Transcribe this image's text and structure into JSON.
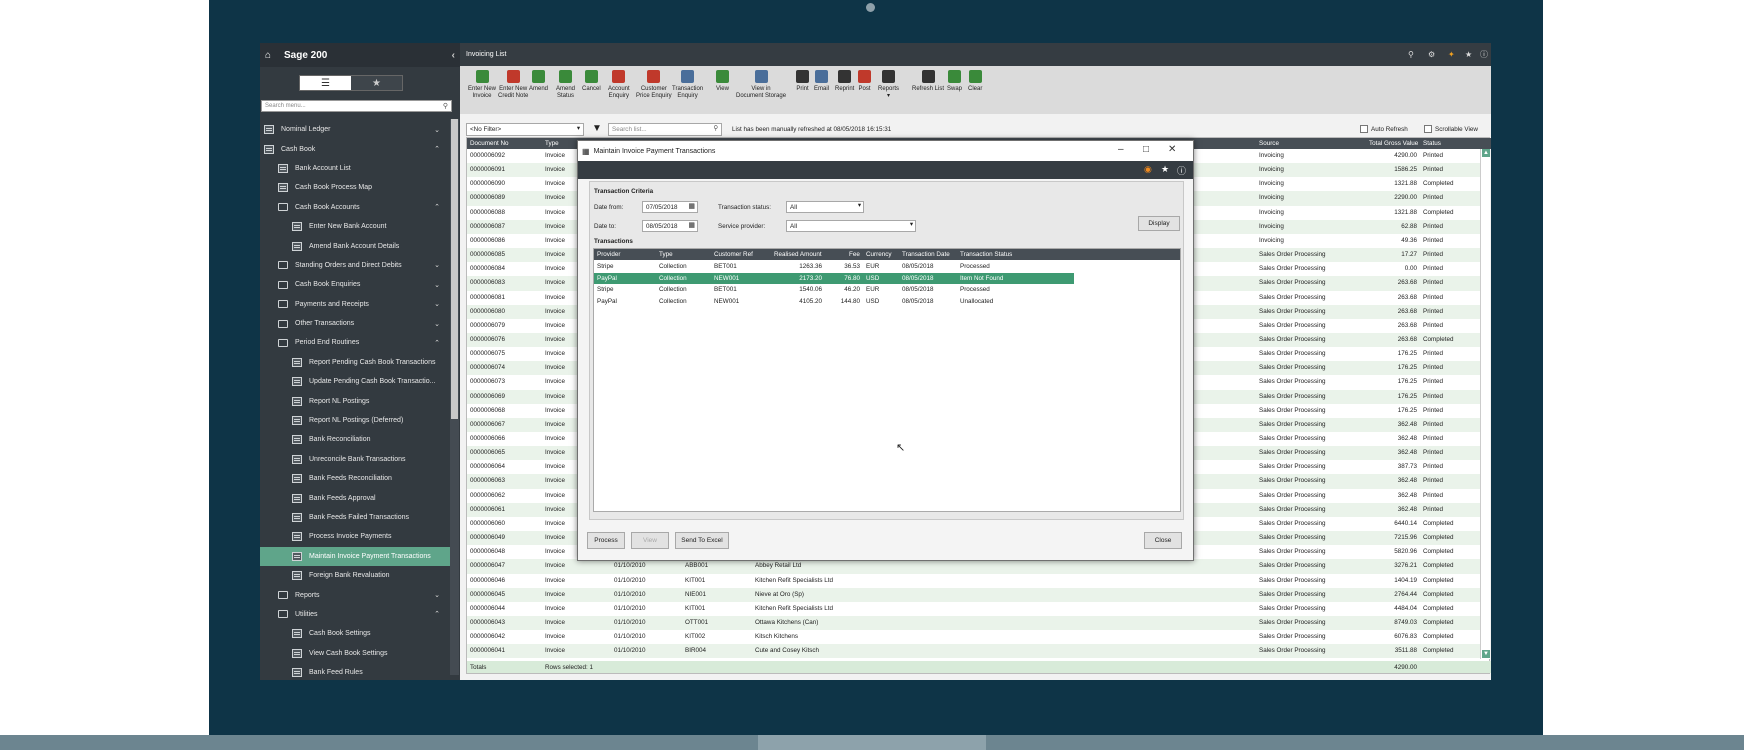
{
  "app": {
    "name": "Sage 200",
    "window_title": "Invoicing List"
  },
  "sidebar": {
    "search_placeholder": "Search menu...",
    "items": [
      {
        "label": "Nominal Ledger",
        "level": 0,
        "icon": "ledger-icon",
        "chev": "⌄"
      },
      {
        "label": "Cash Book",
        "level": 0,
        "icon": "cashbook-icon",
        "chev": "⌃"
      },
      {
        "label": "Bank Account List",
        "level": 1,
        "icon": "doc-icon",
        "chev": ""
      },
      {
        "label": "Cash Book Process Map",
        "level": 1,
        "icon": "doc-icon",
        "chev": ""
      },
      {
        "label": "Cash Book Accounts",
        "level": 1,
        "icon": "folder-icon",
        "chev": "⌃"
      },
      {
        "label": "Enter New Bank Account",
        "level": 2,
        "icon": "doc-icon",
        "chev": ""
      },
      {
        "label": "Amend Bank Account Details",
        "level": 2,
        "icon": "doc-icon",
        "chev": ""
      },
      {
        "label": "Standing Orders and Direct Debits",
        "level": 1,
        "icon": "folder-icon",
        "chev": "⌄"
      },
      {
        "label": "Cash Book Enquiries",
        "level": 1,
        "icon": "folder-icon",
        "chev": "⌄"
      },
      {
        "label": "Payments and Receipts",
        "level": 1,
        "icon": "folder-icon",
        "chev": "⌄"
      },
      {
        "label": "Other Transactions",
        "level": 1,
        "icon": "folder-icon",
        "chev": "⌄"
      },
      {
        "label": "Period End Routines",
        "level": 1,
        "icon": "folder-icon",
        "chev": "⌃"
      },
      {
        "label": "Report Pending Cash Book Transactions",
        "level": 2,
        "icon": "doc-icon",
        "chev": ""
      },
      {
        "label": "Update Pending Cash Book Transactio...",
        "level": 2,
        "icon": "doc-icon",
        "chev": ""
      },
      {
        "label": "Report NL Postings",
        "level": 2,
        "icon": "doc-icon",
        "chev": ""
      },
      {
        "label": "Report NL Postings (Deferred)",
        "level": 2,
        "icon": "doc-icon",
        "chev": ""
      },
      {
        "label": "Bank Reconciliation",
        "level": 2,
        "icon": "doc-icon",
        "chev": ""
      },
      {
        "label": "Unreconcile Bank Transactions",
        "level": 2,
        "icon": "doc-icon",
        "chev": ""
      },
      {
        "label": "Bank Feeds Reconciliation",
        "level": 2,
        "icon": "doc-icon",
        "chev": ""
      },
      {
        "label": "Bank Feeds Approval",
        "level": 2,
        "icon": "doc-icon",
        "chev": ""
      },
      {
        "label": "Bank Feeds Failed Transactions",
        "level": 2,
        "icon": "doc-icon",
        "chev": ""
      },
      {
        "label": "Process Invoice Payments",
        "level": 2,
        "icon": "doc-icon",
        "chev": ""
      },
      {
        "label": "Maintain Invoice Payment Transactions",
        "level": 2,
        "icon": "doc-icon",
        "chev": "",
        "selected": true
      },
      {
        "label": "Foreign Bank Revaluation",
        "level": 2,
        "icon": "doc-icon",
        "chev": ""
      },
      {
        "label": "Reports",
        "level": 1,
        "icon": "folder-icon",
        "chev": "⌄"
      },
      {
        "label": "Utilities",
        "level": 1,
        "icon": "folder-icon",
        "chev": "⌃"
      },
      {
        "label": "Cash Book Settings",
        "level": 2,
        "icon": "doc-icon",
        "chev": ""
      },
      {
        "label": "View Cash Book Settings",
        "level": 2,
        "icon": "doc-icon",
        "chev": ""
      },
      {
        "label": "Bank Feed Rules",
        "level": 2,
        "icon": "doc-icon",
        "chev": ""
      }
    ]
  },
  "toolbar": {
    "buttons": [
      {
        "label": "Enter New\nInvoice",
        "icon": "new-invoice-icon",
        "color": "#3a8a3a"
      },
      {
        "label": "Enter New\nCredit Note",
        "icon": "credit-note-icon",
        "color": "#c0392b"
      },
      {
        "label": "Amend",
        "icon": "amend-icon",
        "color": "#3a8a3a"
      },
      {
        "label": "Amend\nStatus",
        "icon": "amend-status-icon",
        "color": "#3a8a3a"
      },
      {
        "label": "Cancel",
        "icon": "cancel-icon",
        "color": "#3a8a3a"
      },
      {
        "label": "Account\nEnquiry",
        "icon": "account-enquiry-icon",
        "color": "#c0392b"
      },
      {
        "label": "Customer\nPrice Enquiry",
        "icon": "price-enquiry-icon",
        "color": "#c0392b"
      },
      {
        "label": "Transaction\nEnquiry",
        "icon": "transaction-enquiry-icon",
        "color": "#4a6e9a"
      },
      {
        "label": "View",
        "icon": "view-icon",
        "color": "#3a8a3a"
      },
      {
        "label": "View in\nDocument Storage",
        "icon": "document-storage-icon",
        "color": "#4a6e9a"
      },
      {
        "label": "Print",
        "icon": "print-icon",
        "color": "#333"
      },
      {
        "label": "Email",
        "icon": "email-icon",
        "color": "#4a6e9a"
      },
      {
        "label": "Reprint",
        "icon": "reprint-icon",
        "color": "#333"
      },
      {
        "label": "Post",
        "icon": "post-icon",
        "color": "#c0392b"
      },
      {
        "label": "Reports\n▾",
        "icon": "reports-icon",
        "color": "#333"
      },
      {
        "label": "Refresh List",
        "icon": "refresh-icon",
        "color": "#333"
      },
      {
        "label": "Swap",
        "icon": "swap-icon",
        "color": "#3a8a3a"
      },
      {
        "label": "Clear",
        "icon": "clear-icon",
        "color": "#3a8a3a"
      }
    ]
  },
  "filter": {
    "selected": "<No Filter>",
    "search_placeholder": "Search list...",
    "status_text": "List has been manually refreshed at 08/05/2018 16:15:31",
    "auto_refresh": "Auto Refresh",
    "scrollable_view": "Scrollable View"
  },
  "grid": {
    "columns": [
      "Document No",
      "Type",
      "Source",
      "Total Gross Value",
      "Status"
    ],
    "rows": [
      [
        "0000006092",
        "Invoice",
        "",
        "",
        "",
        "Invoicing",
        "4290.00",
        "Printed"
      ],
      [
        "0000006091",
        "Invoice",
        "",
        "",
        "",
        "Invoicing",
        "1586.25",
        "Printed"
      ],
      [
        "0000006090",
        "Invoice",
        "",
        "",
        "",
        "Invoicing",
        "1321.88",
        "Completed"
      ],
      [
        "0000006089",
        "Invoice",
        "",
        "",
        "",
        "Invoicing",
        "2290.00",
        "Printed"
      ],
      [
        "0000006088",
        "Invoice",
        "",
        "",
        "",
        "Invoicing",
        "1321.88",
        "Completed"
      ],
      [
        "0000006087",
        "Invoice",
        "",
        "",
        "",
        "Invoicing",
        "62.88",
        "Printed"
      ],
      [
        "0000006086",
        "Invoice",
        "",
        "",
        "",
        "Invoicing",
        "49.36",
        "Printed"
      ],
      [
        "0000006085",
        "Invoice",
        "",
        "",
        "",
        "Sales Order Processing",
        "17.27",
        "Printed"
      ],
      [
        "0000006084",
        "Invoice",
        "",
        "",
        "",
        "Sales Order Processing",
        "0.00",
        "Printed"
      ],
      [
        "0000006083",
        "Invoice",
        "",
        "",
        "",
        "Sales Order Processing",
        "263.68",
        "Printed"
      ],
      [
        "0000006081",
        "Invoice",
        "",
        "",
        "",
        "Sales Order Processing",
        "263.68",
        "Printed"
      ],
      [
        "0000006080",
        "Invoice",
        "",
        "",
        "",
        "Sales Order Processing",
        "263.68",
        "Printed"
      ],
      [
        "0000006079",
        "Invoice",
        "",
        "",
        "",
        "Sales Order Processing",
        "263.68",
        "Printed"
      ],
      [
        "0000006076",
        "Invoice",
        "",
        "",
        "",
        "Sales Order Processing",
        "263.68",
        "Completed"
      ],
      [
        "0000006075",
        "Invoice",
        "",
        "",
        "",
        "Sales Order Processing",
        "176.25",
        "Printed"
      ],
      [
        "0000006074",
        "Invoice",
        "",
        "",
        "",
        "Sales Order Processing",
        "176.25",
        "Printed"
      ],
      [
        "0000006073",
        "Invoice",
        "",
        "",
        "",
        "Sales Order Processing",
        "176.25",
        "Printed"
      ],
      [
        "0000006069",
        "Invoice",
        "",
        "",
        "",
        "Sales Order Processing",
        "176.25",
        "Printed"
      ],
      [
        "0000006068",
        "Invoice",
        "",
        "",
        "",
        "Sales Order Processing",
        "176.25",
        "Printed"
      ],
      [
        "0000006067",
        "Invoice",
        "",
        "",
        "",
        "Sales Order Processing",
        "362.48",
        "Printed"
      ],
      [
        "0000006066",
        "Invoice",
        "",
        "",
        "",
        "Sales Order Processing",
        "362.48",
        "Printed"
      ],
      [
        "0000006065",
        "Invoice",
        "",
        "",
        "",
        "Sales Order Processing",
        "362.48",
        "Printed"
      ],
      [
        "0000006064",
        "Invoice",
        "",
        "",
        "",
        "Sales Order Processing",
        "387.73",
        "Printed"
      ],
      [
        "0000006063",
        "Invoice",
        "",
        "",
        "",
        "Sales Order Processing",
        "362.48",
        "Printed"
      ],
      [
        "0000006062",
        "Invoice",
        "",
        "",
        "",
        "Sales Order Processing",
        "362.48",
        "Printed"
      ],
      [
        "0000006061",
        "Invoice",
        "",
        "",
        "",
        "Sales Order Processing",
        "362.48",
        "Printed"
      ],
      [
        "0000006060",
        "Invoice",
        "",
        "",
        "",
        "Sales Order Processing",
        "6440.14",
        "Completed"
      ],
      [
        "0000006049",
        "Invoice",
        "",
        "",
        "",
        "Sales Order Processing",
        "7215.96",
        "Completed"
      ],
      [
        "0000006048",
        "Invoice",
        "",
        "",
        "",
        "Sales Order Processing",
        "5820.96",
        "Completed"
      ],
      [
        "0000006047",
        "Invoice",
        "01/10/2010",
        "ABB001",
        "Abbey Retail Ltd",
        "Sales Order Processing",
        "3276.21",
        "Completed"
      ],
      [
        "0000006046",
        "Invoice",
        "01/10/2010",
        "KIT001",
        "Kitchen Refit Specialists Ltd",
        "Sales Order Processing",
        "1404.19",
        "Completed"
      ],
      [
        "0000006045",
        "Invoice",
        "01/10/2010",
        "NIE001",
        "Nieve at Oro (Sp)",
        "Sales Order Processing",
        "2764.44",
        "Completed"
      ],
      [
        "0000006044",
        "Invoice",
        "01/10/2010",
        "KIT001",
        "Kitchen Refit Specialists Ltd",
        "Sales Order Processing",
        "4484.04",
        "Completed"
      ],
      [
        "0000006043",
        "Invoice",
        "01/10/2010",
        "OTT001",
        "Ottawa Kitchens (Can)",
        "Sales Order Processing",
        "8749.03",
        "Completed"
      ],
      [
        "0000006042",
        "Invoice",
        "01/10/2010",
        "KIT002",
        "Kitsch Kitchens",
        "Sales Order Processing",
        "6076.83",
        "Completed"
      ],
      [
        "0000006041",
        "Invoice",
        "01/10/2010",
        "BIR004",
        "Cute and Cosey Kitsch",
        "Sales Order Processing",
        "3511.88",
        "Completed"
      ]
    ],
    "footer": {
      "totals": "Totals",
      "rows_selected": "Rows selected: 1",
      "total_value": "4290.00"
    }
  },
  "dialog": {
    "title": "Maintain Invoice Payment Transactions",
    "criteria_heading": "Transaction Criteria",
    "date_from_label": "Date from:",
    "date_from": "07/05/2018",
    "date_to_label": "Date to:",
    "date_to": "08/05/2018",
    "status_label": "Transaction status:",
    "status_value": "All",
    "provider_label": "Service provider:",
    "provider_value": "All",
    "display_btn": "Display",
    "transactions_heading": "Transactions",
    "columns": [
      "Provider",
      "Type",
      "Customer Ref",
      "Realised Amount",
      "Fee",
      "Currency",
      "Transaction Date",
      "Transaction Status"
    ],
    "rows": [
      [
        "Stripe",
        "Collection",
        "BET001",
        "1263.36",
        "36.53",
        "EUR",
        "08/05/2018",
        "Processed"
      ],
      [
        "PayPal",
        "Collection",
        "NEW001",
        "2173.20",
        "76.80",
        "USD",
        "08/05/2018",
        "Item Not Found"
      ],
      [
        "Stripe",
        "Collection",
        "BET001",
        "1540.06",
        "46.20",
        "EUR",
        "08/05/2018",
        "Processed"
      ],
      [
        "PayPal",
        "Collection",
        "NEW001",
        "4105.20",
        "144.80",
        "USD",
        "08/05/2018",
        "Unallocated"
      ]
    ],
    "buttons": {
      "process": "Process",
      "view": "View",
      "excel": "Send To Excel",
      "close": "Close"
    }
  },
  "colors": {
    "accent": "#5fa58a",
    "highlight": "#3e9a72",
    "bezel": "#0e3447"
  }
}
